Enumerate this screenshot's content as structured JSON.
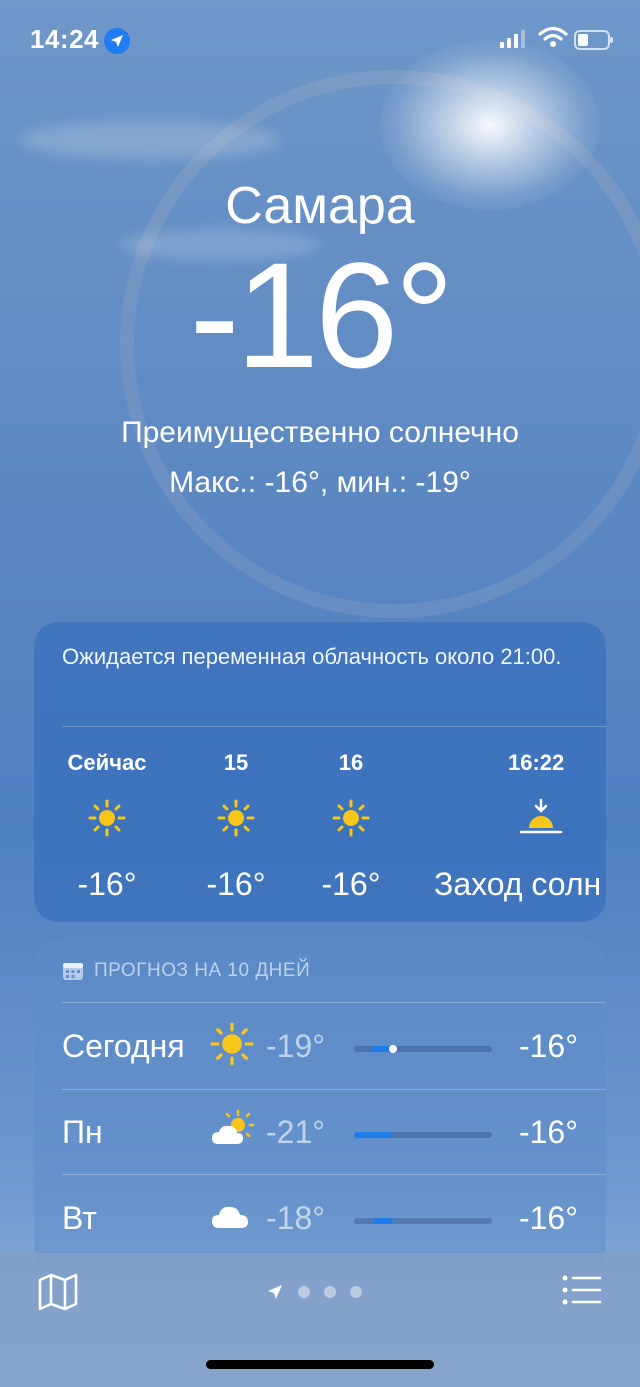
{
  "status": {
    "time": "14:24"
  },
  "location": {
    "city": "Самара",
    "temperature": "-16°",
    "condition": "Преимущественно солнечно",
    "hi_lo": "Макс.: -16°, мин.: -19°"
  },
  "hourly": {
    "summary": "Ожидается переменная облачность около 21:00.",
    "items": [
      {
        "label": "Сейчас",
        "icon": "sun-icon",
        "value": "-16°"
      },
      {
        "label": "15",
        "icon": "sun-icon",
        "value": "-16°"
      },
      {
        "label": "16",
        "icon": "sun-icon",
        "value": "-16°"
      },
      {
        "label": "16:22",
        "icon": "sunset-icon",
        "value": "Заход солн"
      }
    ]
  },
  "forecast": {
    "header": "ПРОГНОЗ НА 10 ДНЕЙ",
    "days": [
      {
        "day": "Сегодня",
        "icon": "sun-icon",
        "min": "-19°",
        "max": "-16°",
        "range_start": 0.12,
        "range_end": 0.28,
        "current": 0.28
      },
      {
        "day": "Пн",
        "icon": "partly-cloudy-icon",
        "min": "-21°",
        "max": "-16°",
        "range_start": 0.0,
        "range_end": 0.28
      },
      {
        "day": "Вт",
        "icon": "cloud-icon",
        "min": "-18°",
        "max": "-16°",
        "range_start": 0.14,
        "range_end": 0.28
      }
    ]
  },
  "colors": {
    "accent": "#1e7de8",
    "sun": "#f6c61a"
  }
}
